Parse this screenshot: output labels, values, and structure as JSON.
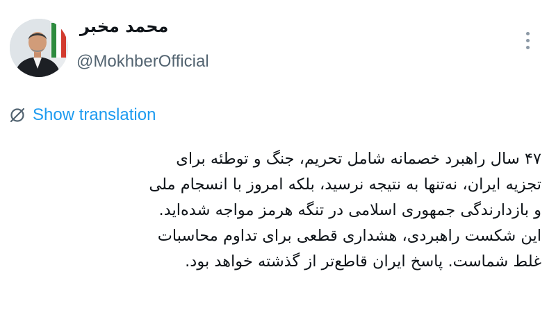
{
  "author": {
    "name": "محمد مخبر",
    "handle": "@MokhberOfficial"
  },
  "translate": {
    "label": "Show translation",
    "icon": "globe-slash-icon"
  },
  "menu": {
    "icon": "more-vertical-icon"
  },
  "tweet": {
    "lines": [
      "۴۷ سال راهبرد خصمانه شامل تحریم، جنگ و توطئه برای",
      "تجزیه ایران، نه‌تنها به نتیجه نرسید، بلکه امروز با انسجام ملی",
      "و بازدارندگی جمهوری اسلامی در تنگه هرمز مواجه شده‌اید.",
      "این شکست راهبردی، هشداری قطعی برای تداوم محاسبات",
      "غلط شماست. پاسخ ایران قاطع‌تر از گذشته خواهد بود."
    ]
  },
  "colors": {
    "link": "#1d9bf0",
    "secondary_text": "#536471",
    "primary_text": "#0f1419"
  }
}
